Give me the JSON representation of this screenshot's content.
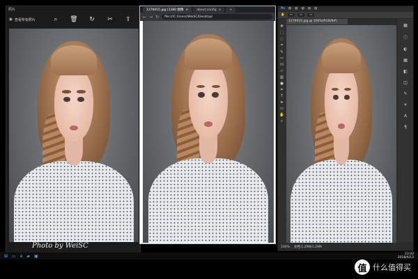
{
  "photos_app": {
    "title": "照片",
    "back_label": "查看所有照片"
  },
  "browser": {
    "tabs": [
      {
        "label": "1276015.jpg (1280 图像"
      },
      {
        "label": "about:config"
      }
    ],
    "url": "file:///C:/Users/WeiSC/Desktop/"
  },
  "photoshop": {
    "document_tab": "1276015.jpg @ 100%(RGB/8#)",
    "status_zoom": "100%",
    "status_doc": "文档:1.29M/1.29M"
  },
  "signature": "Photo by WeiSC",
  "taskbar": {
    "time": "23:33",
    "date": "2018/6/13"
  },
  "watermark": {
    "badge": "值",
    "site": "什么值得买"
  }
}
